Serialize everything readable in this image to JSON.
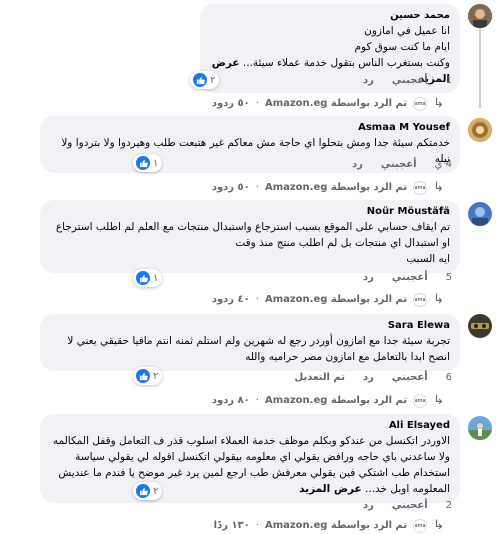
{
  "comments": [
    {
      "author": "محمد حسين",
      "text": "انا عميل في امازون\nايام ما كنت سوق كوم\nوكنت بستغرب الناس بتقول خدمة عملاء سيئة...",
      "see_more": "عرض المزيد",
      "time": "1",
      "like_label": "أعجبني",
      "reply_label": "رد",
      "reactions": "٢",
      "replied_by": "تم الرد بواسطة Amazon.eg",
      "reply_count": "٥٠ ردود"
    },
    {
      "author": "Asmaa M Yousef",
      "text": "خدمتكم سيئة جدا ومش بتحلوا اي حاجة مش معاكم غير هتبعت طلب وهيردوا ولا بتردوا ولا نيله",
      "time": "4 ي",
      "like_label": "أعجبني",
      "reply_label": "رد",
      "reactions": "١",
      "replied_by": "تم الرد بواسطة Amazon.eg",
      "reply_count": "٥٠ ردود"
    },
    {
      "author": "Noür Möustäfä",
      "text": "تم ايقاف حسابي على الموقع بسبب استرجاع واستبدال منتجات مع العلم لم اطلب استرجاع او استبدال اي منتجات بل لم اطلب منتج منذ وقت\nايه السبب",
      "time": "5",
      "like_label": "أعجبني",
      "reply_label": "رد",
      "reactions": "١",
      "replied_by": "تم الرد بواسطة Amazon.eg",
      "reply_count": "٤٠ ردود"
    },
    {
      "author": "Sara Elewa",
      "text": "تجربة سيئة جدا مع امازون أوردر رجع له شهرين ولم استلم ثمنه انتم مافيا حقيقي يعني لا انصح ابدا بالتعامل مع امازون مصر حراميه والله",
      "time": "6",
      "like_label": "أعجبني",
      "reply_label": "رد",
      "edited_label": "تم التعديل",
      "reactions": "٢",
      "replied_by": "تم الرد بواسطة Amazon.eg",
      "reply_count": "٨٠ ردود"
    },
    {
      "author": "Ali Elsayed",
      "text": "الاوردر اتكنسل من عندكو وبكلم موظف خدمة العملاء اسلوب قذر ف التعامل وقفل المكالمه ولا ساعدني باي حاجه ورافض يقولي اي معلومه بيقولي اتكنسل اقوله لي يقولي سياسة استخدام طب اشتكي فين يقولي معرفش طب ارجع لمين يرد غير موضح يا فندم ما عنديش المعلومه اوبل خد...",
      "see_more": "عرض المزيد",
      "time": "2",
      "like_label": "أعجبني",
      "reply_label": "رد",
      "reactions": "٢",
      "replied_by": "تم الرد بواسطة Amazon.eg",
      "reply_count": "١٣٠ ردًا"
    }
  ],
  "colors": {
    "like_blue": "#1877f2",
    "bubble": "#f0f2f5",
    "muted": "#65676b"
  }
}
